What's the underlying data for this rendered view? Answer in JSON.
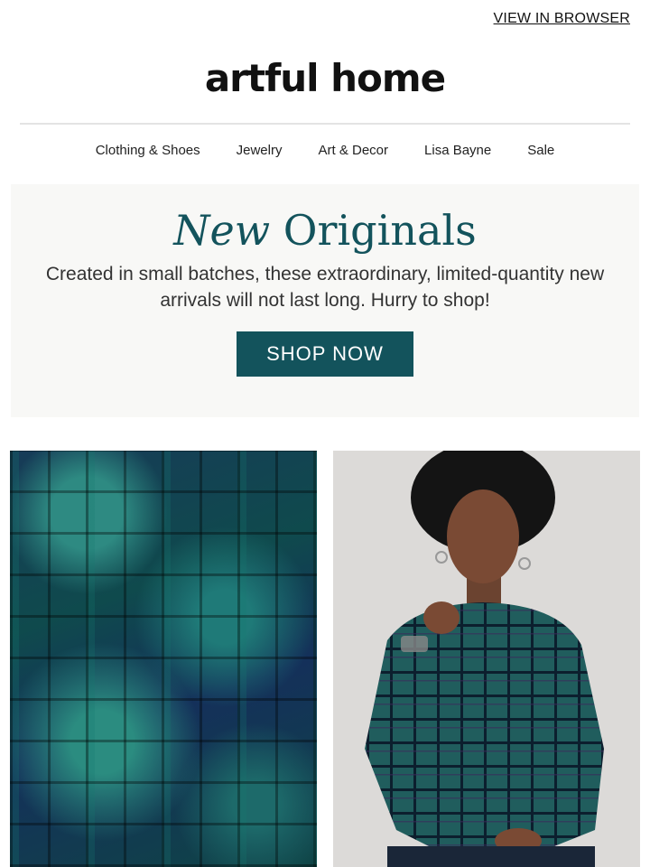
{
  "header": {
    "view_in_browser": "VIEW IN BROWSER",
    "logo": "artful home"
  },
  "nav": {
    "items": [
      "Clothing & Shoes",
      "Jewelry",
      "Art & Decor",
      "Lisa Bayne",
      "Sale"
    ]
  },
  "hero": {
    "title_italic": "New",
    "title_rest": "Originals",
    "text": "Created in small batches, these extraordinary, limited-quantity new arrivals will not last long. Hurry to shop!",
    "button": "SHOP NOW"
  },
  "images": {
    "left": "plaid-fabric-closeup",
    "right": "model-wearing-plaid-top"
  },
  "colors": {
    "accent": "#13535c",
    "hero_bg": "#f8f8f6"
  }
}
